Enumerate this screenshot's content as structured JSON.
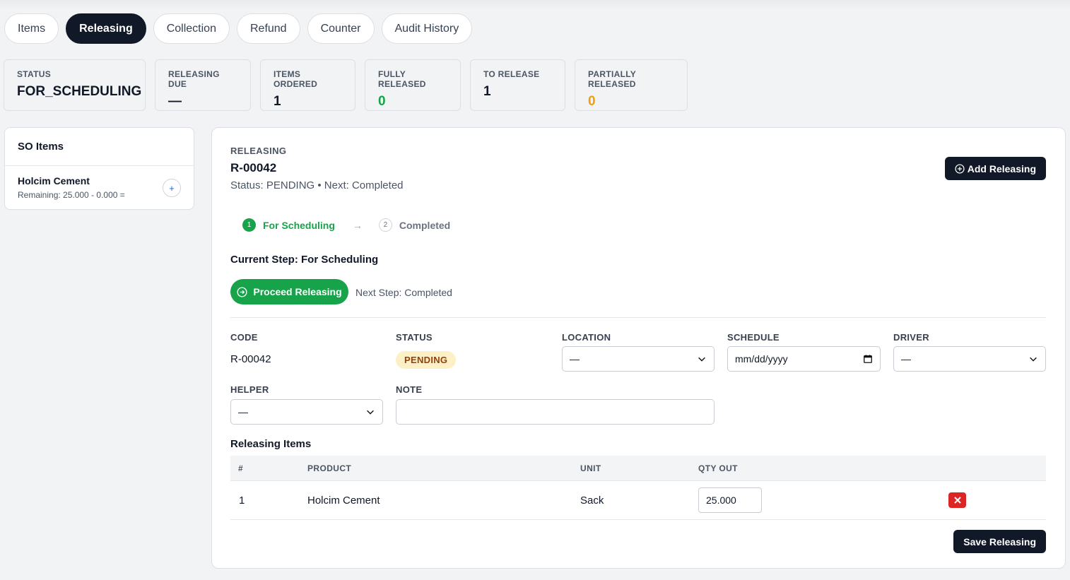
{
  "tabs": [
    {
      "label": "Items",
      "active": false
    },
    {
      "label": "Releasing",
      "active": true
    },
    {
      "label": "Collection",
      "active": false
    },
    {
      "label": "Refund",
      "active": false
    },
    {
      "label": "Counter",
      "active": false
    },
    {
      "label": "Audit History",
      "active": false
    }
  ],
  "stats": [
    {
      "label": "STATUS",
      "value": "FOR_SCHEDULING",
      "color": "#111827"
    },
    {
      "label": "RELEASING DUE",
      "value": "—",
      "color": "#111827"
    },
    {
      "label": "ITEMS ORDERED",
      "value": "1",
      "color": "#111827"
    },
    {
      "label": "FULLY RELEASED",
      "value": "0",
      "color": "#16a34a"
    },
    {
      "label": "TO RELEASE",
      "value": "1",
      "color": "#111827"
    },
    {
      "label": "PARTIALLY RELEASED",
      "value": "0",
      "color": "#f59e0b"
    }
  ],
  "so_items": {
    "title": "SO Items",
    "items": [
      {
        "name": "Holcim Cement",
        "remaining": "Remaining: 25.000 - 0.000 =",
        "add_icon": "plus-icon"
      }
    ]
  },
  "releasing": {
    "eyebrow": "RELEASING",
    "code": "R-00042",
    "status_line": "Status: PENDING • Next: Completed",
    "add_button": "Add Releasing",
    "steps": [
      {
        "num": "1",
        "label": "For Scheduling",
        "state": "current"
      },
      {
        "num": "2",
        "label": "Completed",
        "state": "pending"
      }
    ],
    "step_arrow": "→",
    "current_step": "Current Step: For Scheduling",
    "proceed_button": "Proceed Releasing",
    "next_step": "Next Step: Completed",
    "fields": {
      "code_label": "CODE",
      "code_value": "R-00042",
      "status_label": "STATUS",
      "status_value": "PENDING",
      "location_label": "LOCATION",
      "location_value": "—",
      "schedule_label": "SCHEDULE",
      "schedule_placeholder": "mm/dd/yyyy",
      "driver_label": "DRIVER",
      "driver_value": "—",
      "helper_label": "HELPER",
      "helper_value": "—",
      "note_label": "NOTE",
      "note_value": ""
    },
    "items_title": "Releasing Items",
    "table": {
      "headers": [
        "#",
        "PRODUCT",
        "UNIT",
        "QTY OUT"
      ],
      "rows": [
        {
          "num": "1",
          "product": "Holcim Cement",
          "unit": "Sack",
          "qty": "25.000"
        }
      ]
    },
    "save_button": "Save Releasing"
  }
}
